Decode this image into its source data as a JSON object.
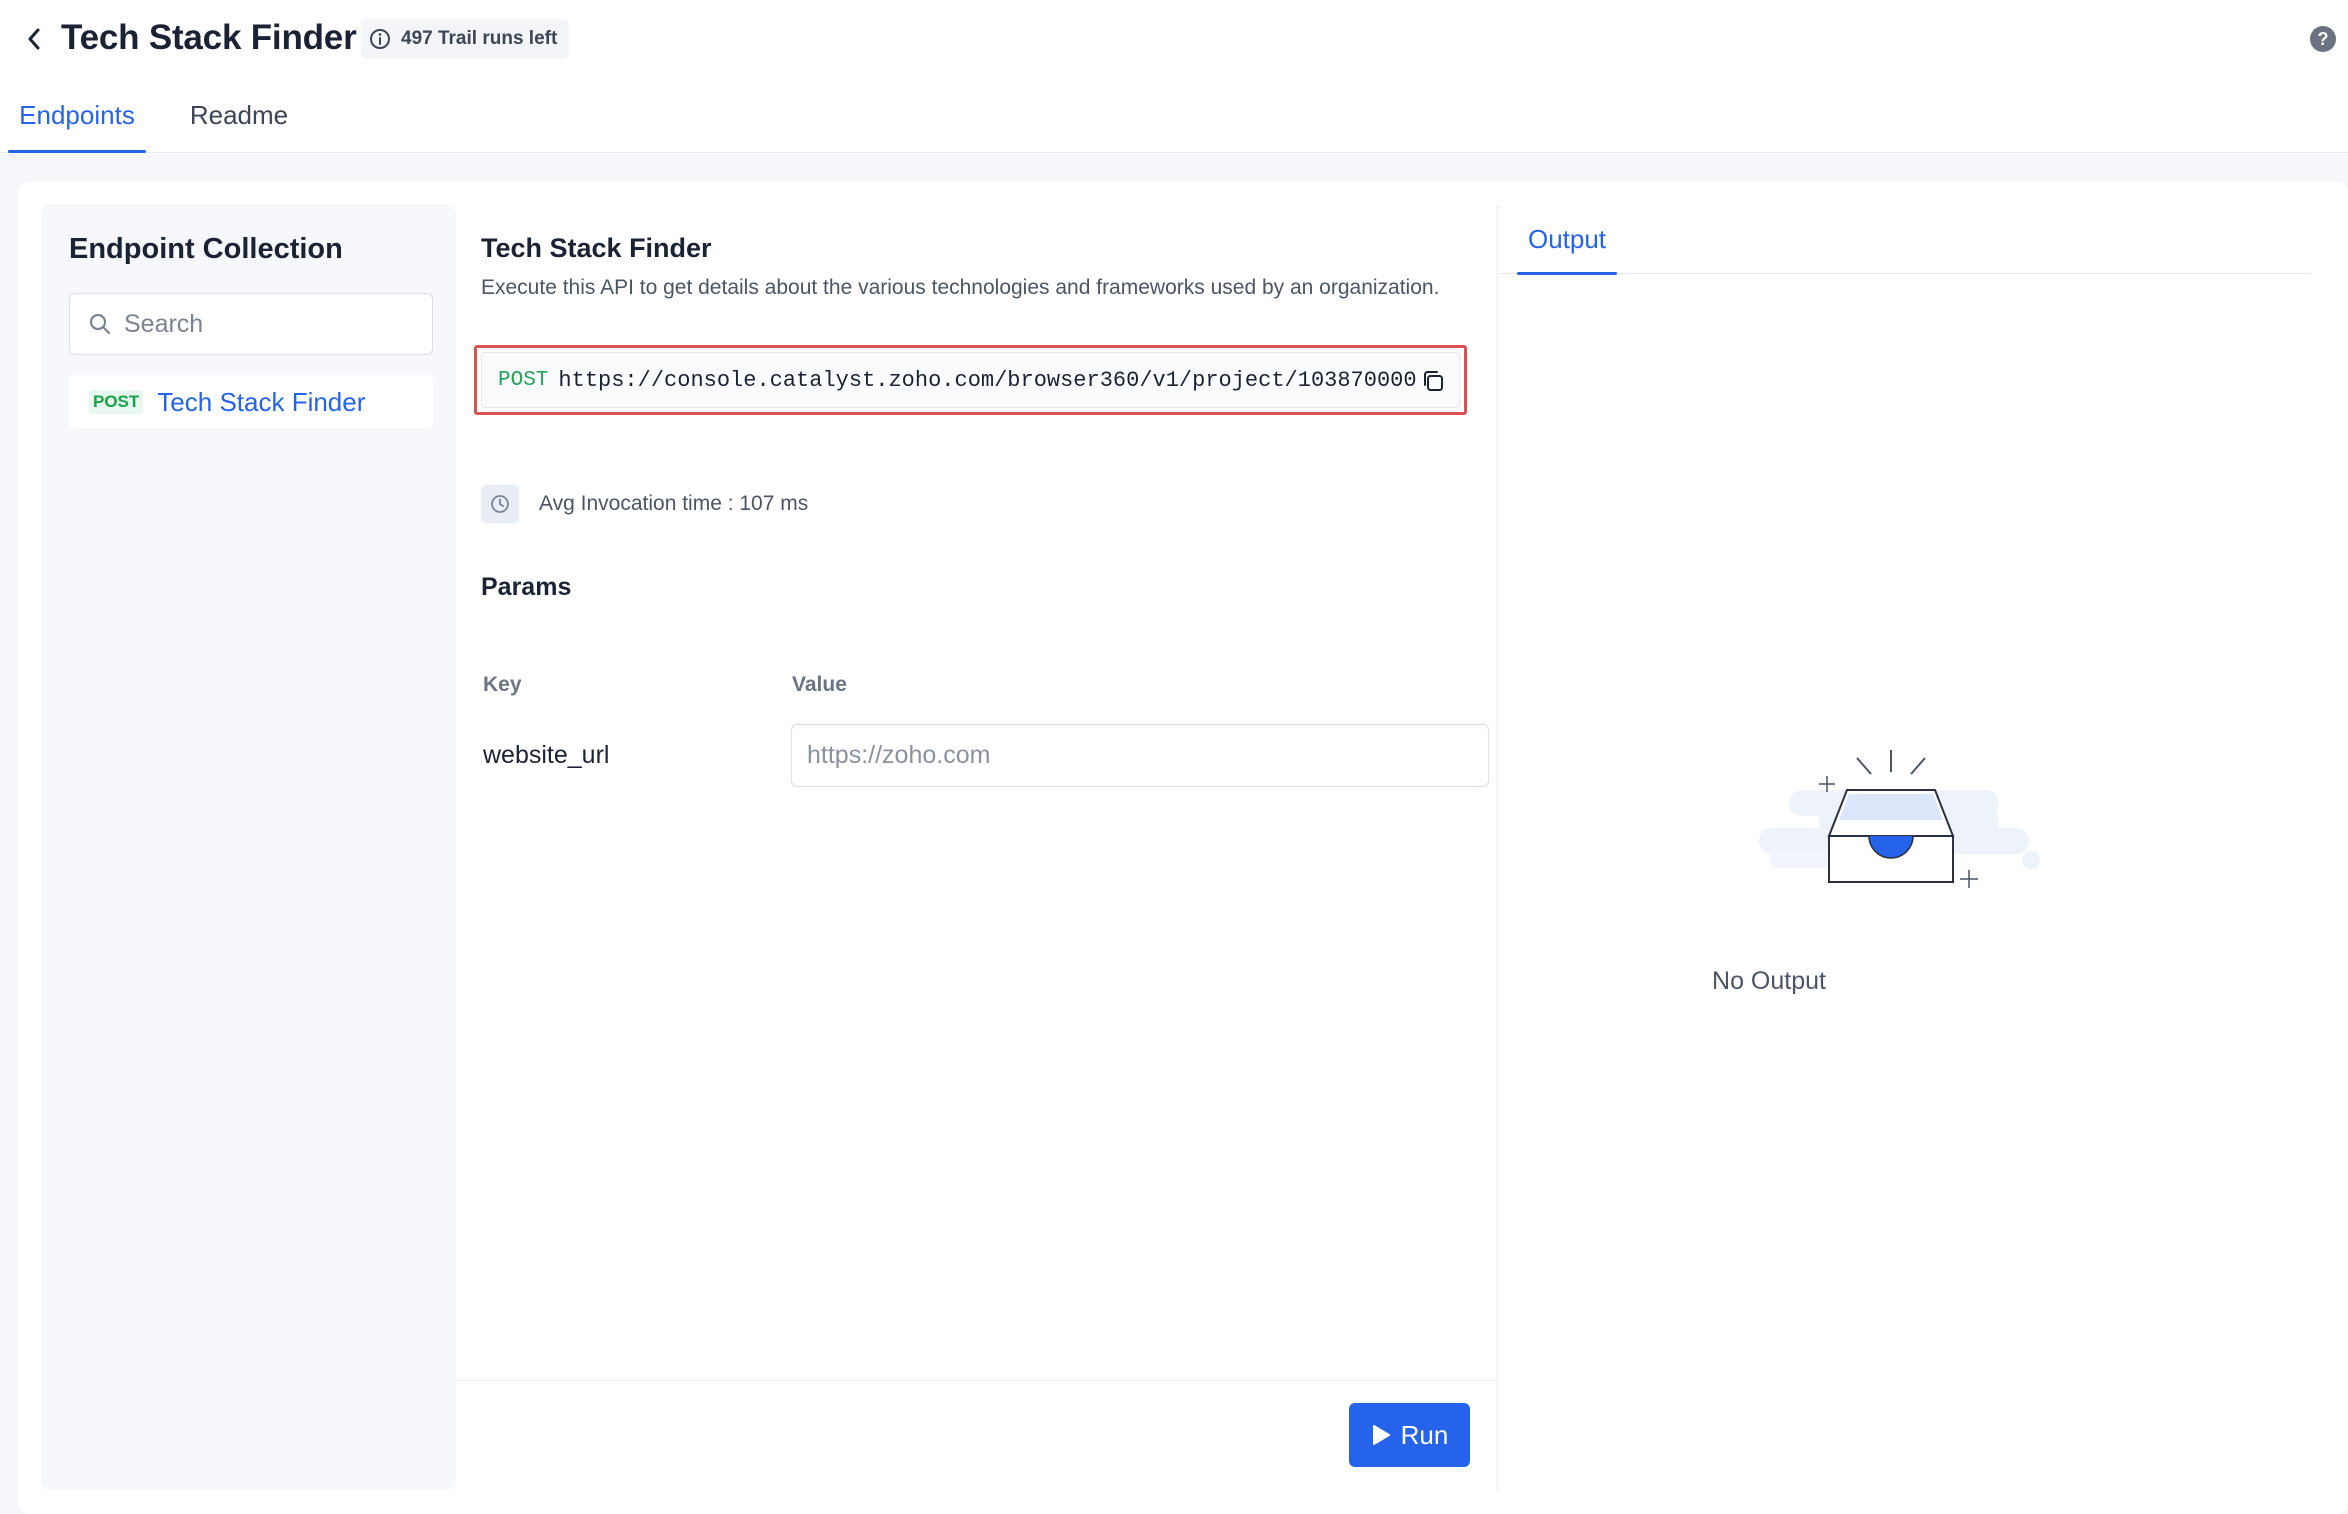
{
  "header": {
    "title": "Tech Stack Finder",
    "runs_badge": "497 Trail runs left"
  },
  "tabs": [
    {
      "label": "Endpoints",
      "active": true
    },
    {
      "label": "Readme",
      "active": false
    }
  ],
  "sidebar": {
    "title": "Endpoint Collection",
    "search_placeholder": "Search",
    "endpoints": [
      {
        "method": "POST",
        "label": "Tech Stack Finder"
      }
    ]
  },
  "endpoint": {
    "title": "Tech Stack Finder",
    "description": "Execute this API to get details about the various technologies and frameworks used by an organization.",
    "method": "POST",
    "url": "https://console.catalyst.zoho.com/browser360/v1/project/103870000",
    "avg_invocation": "Avg Invocation time : 107 ms"
  },
  "params": {
    "title": "Params",
    "key_header": "Key",
    "value_header": "Value",
    "rows": [
      {
        "key": "website_url",
        "placeholder": "https://zoho.com",
        "value": ""
      }
    ]
  },
  "actions": {
    "run_label": "Run"
  },
  "output": {
    "tab_label": "Output",
    "empty_text": "No Output"
  },
  "colors": {
    "accent": "#2563eb",
    "method_post": "#16a34a",
    "highlight_border": "#d9534f"
  }
}
